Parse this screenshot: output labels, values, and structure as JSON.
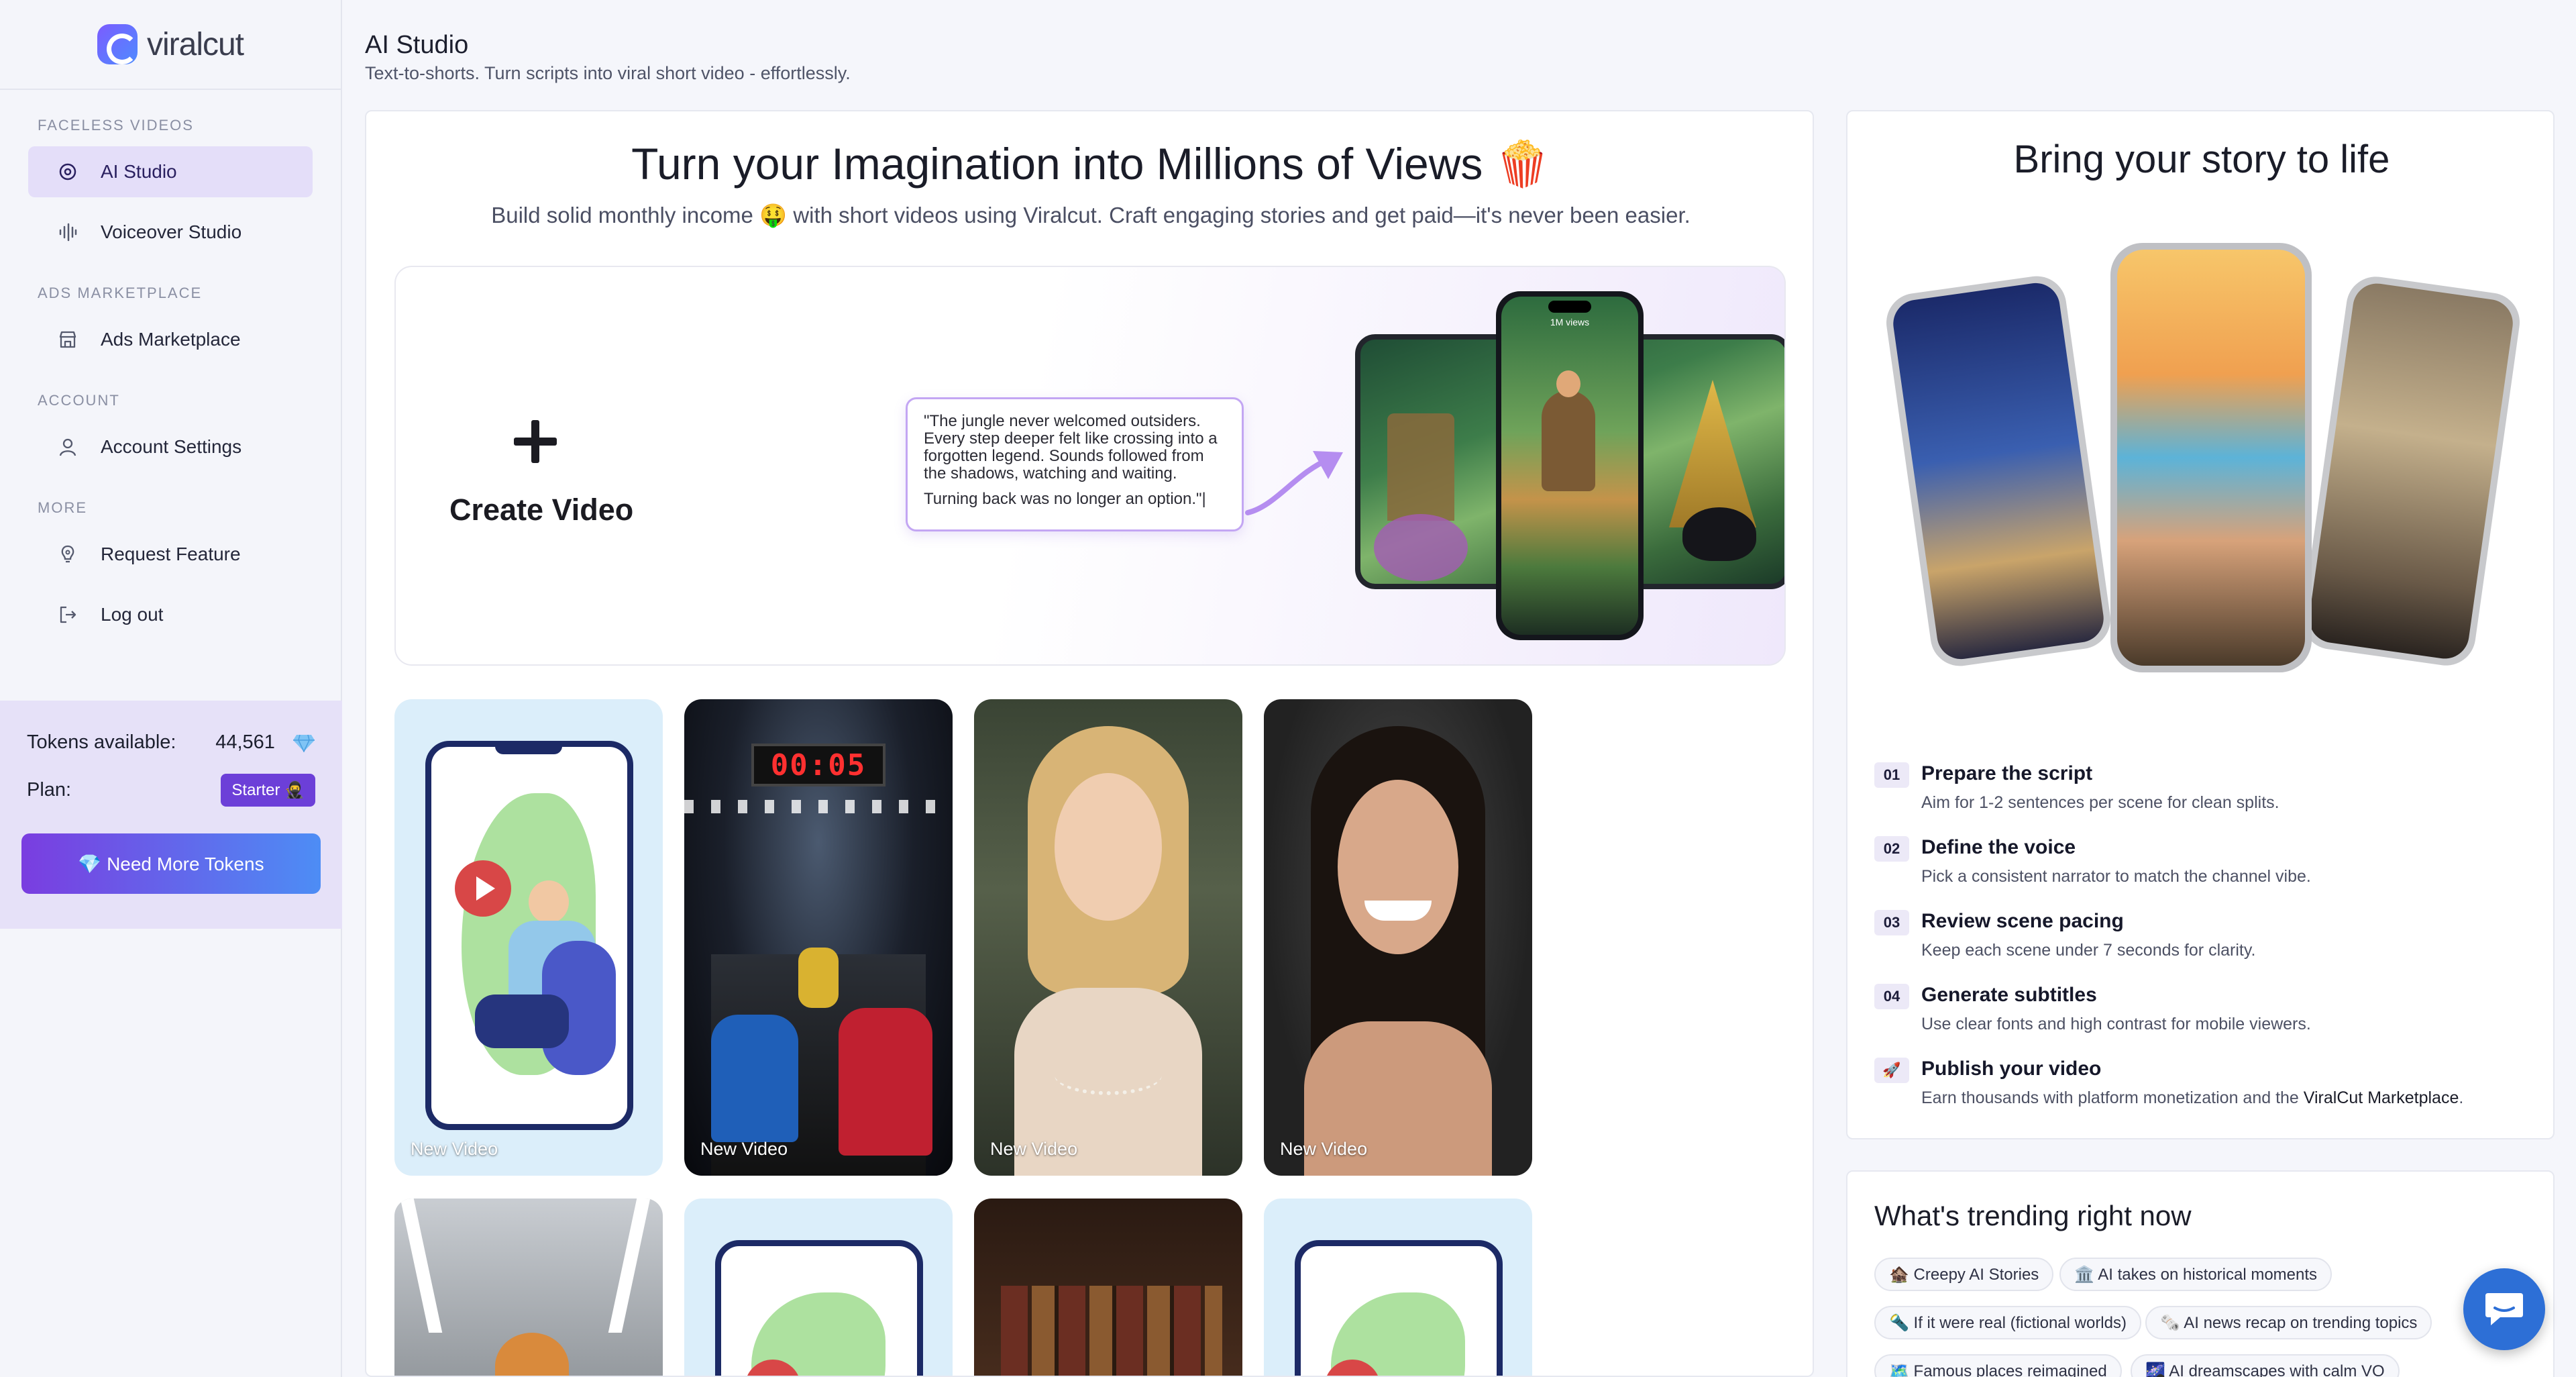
{
  "app": {
    "logo_text": "viralcut"
  },
  "sidebar": {
    "sections": [
      {
        "title": "FACELESS VIDEOS",
        "items": [
          {
            "label": "AI Studio",
            "active": true,
            "icon": "ai-sparkle-icon"
          },
          {
            "label": "Voiceover Studio",
            "icon": "waveform-icon"
          }
        ]
      },
      {
        "title": "ADS MARKETPLACE",
        "items": [
          {
            "label": "Ads Marketplace",
            "icon": "store-icon"
          }
        ]
      },
      {
        "title": "ACCOUNT",
        "items": [
          {
            "label": "Account Settings",
            "icon": "user-icon"
          }
        ]
      },
      {
        "title": "MORE",
        "items": [
          {
            "label": "Request Feature",
            "icon": "lightbulb-icon"
          },
          {
            "label": "Log out",
            "icon": "logout-icon"
          }
        ]
      }
    ],
    "tokens": {
      "label": "Tokens available:",
      "value": "44,561",
      "plan_label": "Plan:",
      "plan_value": "Starter 🥷",
      "button_label": "💎 Need More Tokens"
    }
  },
  "header": {
    "title": "AI Studio",
    "subtitle": "Text-to-shorts. Turn scripts into viral short video - effortlessly."
  },
  "main": {
    "hero_title": "Turn your Imagination into Millions of Views 🍿",
    "hero_subtitle": "Build solid monthly income 🤑 with short videos using Viralcut. Craft engaging stories and get paid—it's never been easier.",
    "create_label": "Create Video",
    "quote_lines": [
      "\"The jungle never welcomed outsiders.",
      "Every step deeper felt like crossing into a",
      "forgotten legend. Sounds followed from",
      "the shadows, watching and waiting."
    ],
    "quote_last": "Turning back was no longer an option.\"|",
    "phone_views": "1M views",
    "timer_text": "00:05",
    "tiles": [
      {
        "label": "New Video"
      },
      {
        "label": "New Video"
      },
      {
        "label": "New Video"
      },
      {
        "label": "New Video"
      }
    ]
  },
  "right": {
    "title": "Bring your story to life",
    "steps": [
      {
        "num": "01",
        "title": "Prepare the script",
        "desc": "Aim for 1-2 sentences per scene for clean splits."
      },
      {
        "num": "02",
        "title": "Define the voice",
        "desc": "Pick a consistent narrator to match the channel vibe."
      },
      {
        "num": "03",
        "title": "Review scene pacing",
        "desc": "Keep each scene under 7 seconds for clarity."
      },
      {
        "num": "04",
        "title": "Generate subtitles",
        "desc": "Use clear fonts and high contrast for mobile viewers."
      },
      {
        "num": "🚀",
        "title": "Publish your video",
        "desc": "Earn thousands with platform monetization and the ",
        "link": "ViralCut Marketplace",
        "desc_end": "."
      }
    ],
    "trending": {
      "title": "What's trending right now",
      "chips": [
        "🏚️ Creepy AI Stories",
        "🏛️ AI takes on historical moments",
        "🔦 If it were real (fictional worlds)",
        "🗞️ AI news recap on trending topics",
        "🗺️ Famous places reimagined",
        "🌌 AI dreamscapes with calm VO"
      ]
    }
  }
}
